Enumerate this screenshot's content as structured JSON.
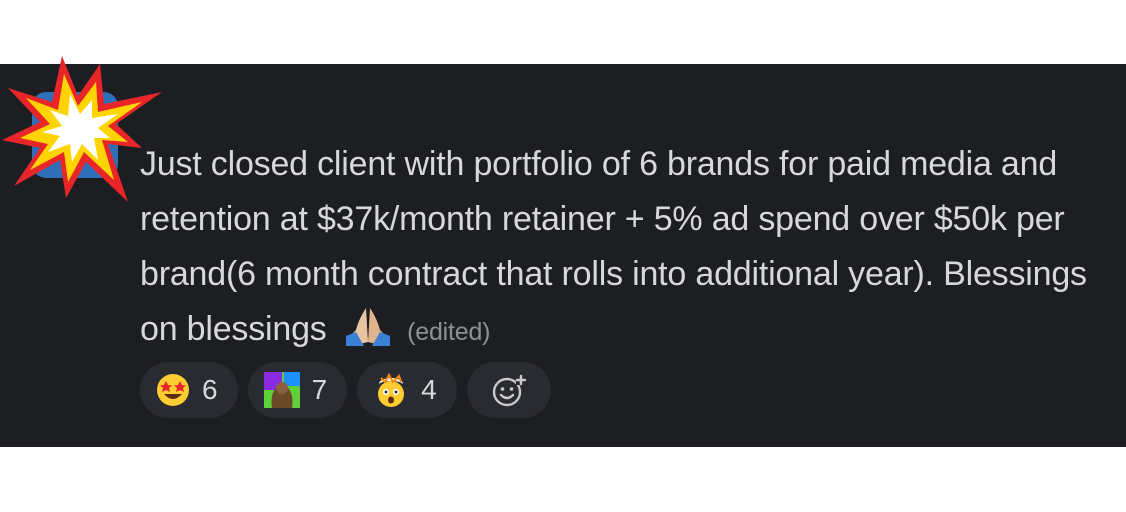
{
  "message": {
    "text": "Just closed client with portfolio of 6 brands for paid media and retention at $37k/month retainer + 5% ad spend over $50k per brand(6 month contract that rolls into additional year). Blessings on blessings",
    "edited_label": "(edited)",
    "trailing_emoji": "folded-hands-icon"
  },
  "reactions": [
    {
      "icon": "star-struck-emoji-icon",
      "count": "6"
    },
    {
      "icon": "custom-gorilla-emoji-icon",
      "count": "7"
    },
    {
      "icon": "exploding-head-emoji-icon",
      "count": "4"
    }
  ],
  "add_reaction": {
    "icon": "add-reaction-icon"
  },
  "colors": {
    "background": "#1d1e22",
    "text": "#d7d8da",
    "muted": "#8e9096",
    "chip": "#2a2b30",
    "avatar": "#2f6fb8"
  }
}
